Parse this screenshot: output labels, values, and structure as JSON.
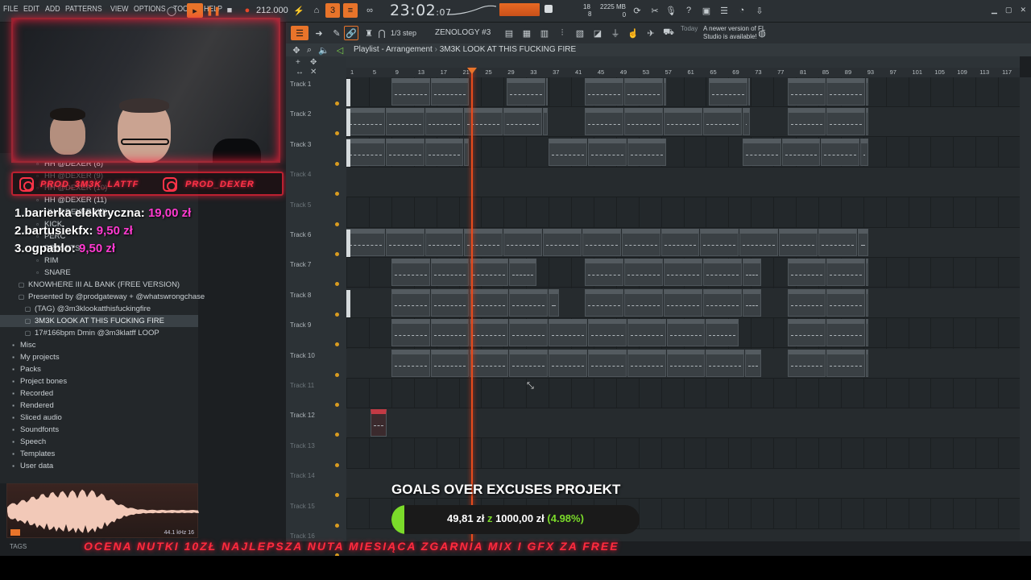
{
  "menu": [
    "FILE",
    "EDIT",
    "ADD",
    "PATTERNS",
    "VIEW",
    "OPTIONS",
    "TOOLS",
    "HELP"
  ],
  "transport": {
    "tempo": "212.000",
    "time": "23:02",
    "time_small": "07",
    "bst": "B:S:T"
  },
  "system": {
    "pattern_pos": "18",
    "pattern_num": "8",
    "memory": "2225 MB",
    "mem_sub": "0"
  },
  "toolbar2": {
    "step": "1/3 step",
    "pattern": "ZENOLOGY #3",
    "news_date": "Today",
    "news_text": "A newer version of FL Studio is available!"
  },
  "social": {
    "left": "PROD_3M3K_LATTF",
    "right": "PROD_DEXER"
  },
  "donations": [
    {
      "rank": "1.",
      "name": "barierka elektryczna:",
      "amount": "19,00 zł"
    },
    {
      "rank": "2.",
      "name": "bartusiekfx:",
      "amount": "9,50 zł"
    },
    {
      "rank": "3.",
      "name": "ogpablo:",
      "amount": "9,50 zł"
    }
  ],
  "browser": {
    "items": [
      "HH @DEXER (8)",
      "HH @DEXER (9)",
      "HH @DEXER (10)",
      "HH @DEXER (11)",
      "HH @DEXER (12)",
      "KICK",
      "PERC",
      "PRESETS",
      "RIM",
      "SNARE",
      "KNOWHERE III AL BANK (FREE VERSION)",
      "Presented by @prodgateway + @whatswrongchase",
      "(TAG) @3m3klookatthisfuckingfire",
      "3M3K LOOK AT THIS FUCKING FIRE",
      "17#166bpm Dmin @3m3klatff LOOP"
    ],
    "folders": [
      "Misc",
      "My projects",
      "Packs",
      "Project bones",
      "Recorded",
      "Rendered",
      "Sliced audio",
      "Soundfonts",
      "Speech",
      "Templates",
      "User data"
    ],
    "preview_info": "44.1 kHz 16",
    "tags_label": "TAGS"
  },
  "playlist": {
    "title": "Playlist - Arrangement",
    "project": "3M3K LOOK AT THIS FUCKING FIRE",
    "ruler": [
      "1",
      "5",
      "9",
      "13",
      "17",
      "21",
      "25",
      "29",
      "33",
      "37",
      "41",
      "45",
      "49",
      "53",
      "57",
      "61",
      "65",
      "69",
      "73",
      "77",
      "81",
      "85",
      "89",
      "93",
      "97",
      "101",
      "105",
      "109",
      "113",
      "117"
    ],
    "tracks": [
      "Track 1",
      "Track 2",
      "Track 3",
      "Track 4",
      "Track 5",
      "Track 6",
      "Track 7",
      "Track 8",
      "Track 9",
      "Track 10",
      "Track 11",
      "Track 12",
      "Track 13",
      "Track 14",
      "Track 15",
      "Track 16"
    ],
    "clip_labels": {
      "t1": "ZE..3",
      "t2": "ZE..Y",
      "t3": "ZE..2",
      "t6": "@macsh..z 808",
      "t7": "SNARE..ER (6)",
      "t8": "[ES25..emics_]",
      "t9": "[ES25..ics_]",
      "t10": "[E..]",
      "t12": "3M3K"
    }
  },
  "goal": {
    "title": "GOALS OVER EXCUSES PROJEKT",
    "current": "49,81 zł",
    "sep": "z",
    "target": "1000,00 zł",
    "pct": "(4.98%)",
    "fraction": 0.0498
  },
  "ticker": "OCENA NUTKI 10ZŁ   NAJLEPSZA NUTA MIESIĄCA ZGARNIA MIX I GFX ZA FREE"
}
